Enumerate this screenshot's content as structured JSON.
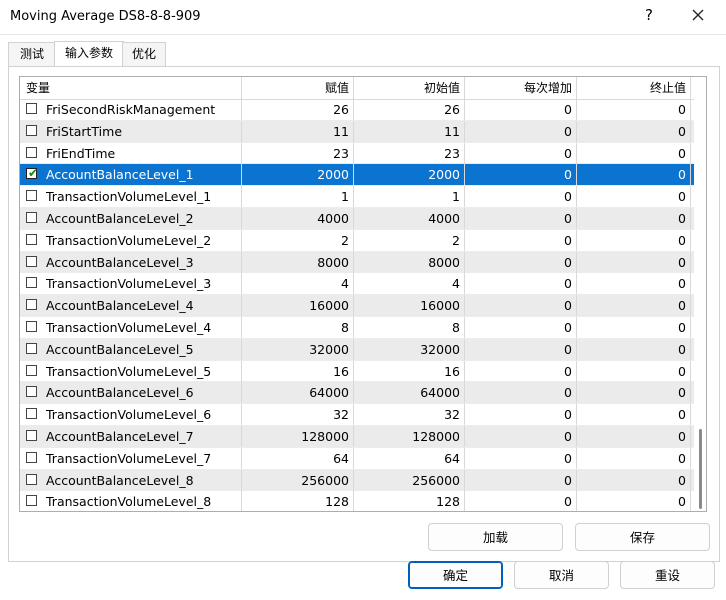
{
  "window": {
    "title": "Moving Average DS8-8-8-909",
    "help_label": "?"
  },
  "tabs": [
    {
      "label": "测试"
    },
    {
      "label": "输入参数"
    },
    {
      "label": "优化"
    }
  ],
  "table": {
    "columns": [
      "变量",
      "赋值",
      "初始值",
      "每次增加",
      "终止值"
    ],
    "rows": [
      {
        "name": "FriSecondRiskManagement",
        "value": "26",
        "start": "26",
        "step": "0",
        "stop": "0",
        "checked": false
      },
      {
        "name": "FriStartTime",
        "value": "11",
        "start": "11",
        "step": "0",
        "stop": "0",
        "checked": false
      },
      {
        "name": "FriEndTime",
        "value": "23",
        "start": "23",
        "step": "0",
        "stop": "0",
        "checked": false
      },
      {
        "name": "AccountBalanceLevel_1",
        "value": "2000",
        "start": "2000",
        "step": "0",
        "stop": "0",
        "checked": true
      },
      {
        "name": "TransactionVolumeLevel_1",
        "value": "1",
        "start": "1",
        "step": "0",
        "stop": "0",
        "checked": false
      },
      {
        "name": "AccountBalanceLevel_2",
        "value": "4000",
        "start": "4000",
        "step": "0",
        "stop": "0",
        "checked": false
      },
      {
        "name": "TransactionVolumeLevel_2",
        "value": "2",
        "start": "2",
        "step": "0",
        "stop": "0",
        "checked": false
      },
      {
        "name": "AccountBalanceLevel_3",
        "value": "8000",
        "start": "8000",
        "step": "0",
        "stop": "0",
        "checked": false
      },
      {
        "name": "TransactionVolumeLevel_3",
        "value": "4",
        "start": "4",
        "step": "0",
        "stop": "0",
        "checked": false
      },
      {
        "name": "AccountBalanceLevel_4",
        "value": "16000",
        "start": "16000",
        "step": "0",
        "stop": "0",
        "checked": false
      },
      {
        "name": "TransactionVolumeLevel_4",
        "value": "8",
        "start": "8",
        "step": "0",
        "stop": "0",
        "checked": false
      },
      {
        "name": "AccountBalanceLevel_5",
        "value": "32000",
        "start": "32000",
        "step": "0",
        "stop": "0",
        "checked": false
      },
      {
        "name": "TransactionVolumeLevel_5",
        "value": "16",
        "start": "16",
        "step": "0",
        "stop": "0",
        "checked": false
      },
      {
        "name": "AccountBalanceLevel_6",
        "value": "64000",
        "start": "64000",
        "step": "0",
        "stop": "0",
        "checked": false
      },
      {
        "name": "TransactionVolumeLevel_6",
        "value": "32",
        "start": "32",
        "step": "0",
        "stop": "0",
        "checked": false
      },
      {
        "name": "AccountBalanceLevel_7",
        "value": "128000",
        "start": "128000",
        "step": "0",
        "stop": "0",
        "checked": false
      },
      {
        "name": "TransactionVolumeLevel_7",
        "value": "64",
        "start": "64",
        "step": "0",
        "stop": "0",
        "checked": false
      },
      {
        "name": "AccountBalanceLevel_8",
        "value": "256000",
        "start": "256000",
        "step": "0",
        "stop": "0",
        "checked": false
      },
      {
        "name": "TransactionVolumeLevel_8",
        "value": "128",
        "start": "128",
        "step": "0",
        "stop": "0",
        "checked": false
      }
    ],
    "selected_row": 3
  },
  "buttons": {
    "load": "加载",
    "save": "保存",
    "ok": "确定",
    "cancel": "取消",
    "reset": "重设"
  },
  "colors": {
    "selection": "#0a74d0",
    "primary_border": "#005fb8",
    "alt_row": "#ebebeb"
  },
  "icons": {
    "close": "close-icon",
    "check": "check-icon"
  }
}
